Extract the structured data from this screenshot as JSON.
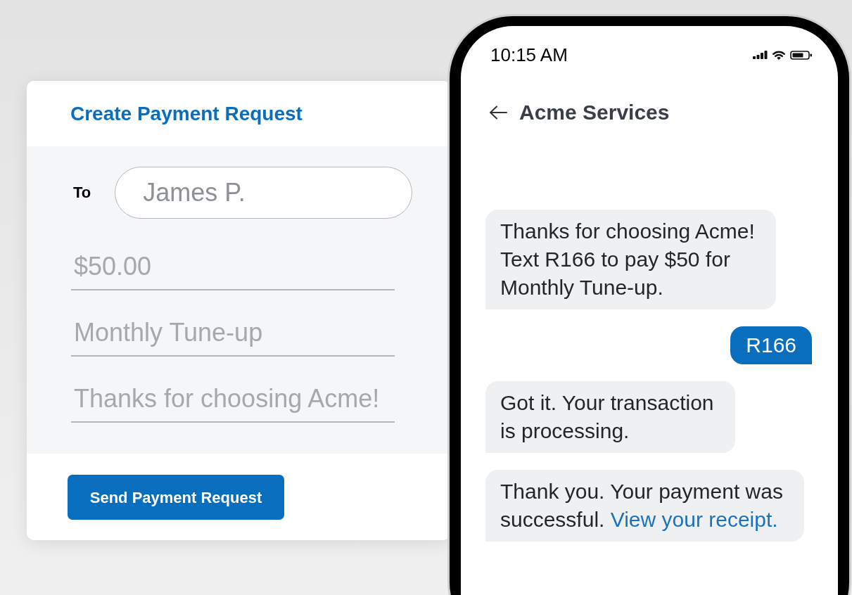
{
  "payment_request_card": {
    "title": "Create Payment Request",
    "recipient": {
      "label": "To",
      "value": "James P."
    },
    "fields": [
      {
        "value": "$50.00"
      },
      {
        "value": "Monthly Tune-up"
      },
      {
        "value": "Thanks for choosing Acme!"
      }
    ],
    "submit_button": "Send Payment Request"
  },
  "phone": {
    "status_bar": {
      "time": "10:15 AM"
    },
    "header": {
      "title": "Acme Services"
    },
    "messages": [
      {
        "kind": "incoming",
        "lines": [
          "Thanks for choosing Acme!",
          "Text R166 to pay $50 for",
          "Monthly Tune-up."
        ]
      },
      {
        "kind": "outgoing",
        "lines": [
          "R166"
        ]
      },
      {
        "kind": "incoming",
        "lines": [
          "Got it. Your transaction",
          "is processing."
        ]
      },
      {
        "kind": "incoming",
        "lines": [
          "Thank you. Your payment was",
          "successful."
        ],
        "link": "View your receipt."
      }
    ]
  }
}
